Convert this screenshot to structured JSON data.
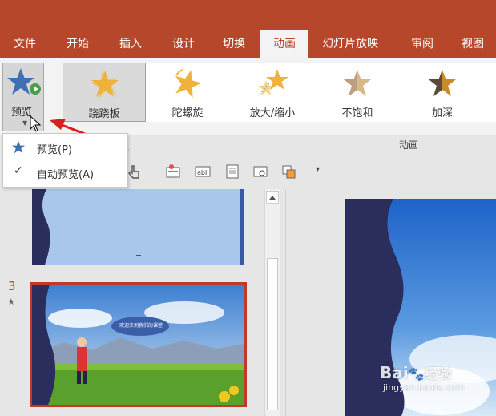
{
  "tabs": [
    "文件",
    "开始",
    "插入",
    "设计",
    "切换",
    "动画",
    "幻灯片放映",
    "审阅",
    "视图"
  ],
  "active_tab": "动画",
  "preview_button": {
    "label": "预览",
    "icon": "star-play-icon"
  },
  "animations": [
    {
      "label": "跷跷板",
      "icon": "teeter-star-icon",
      "selected": true
    },
    {
      "label": "陀螺旋",
      "icon": "spin-star-icon",
      "selected": false
    },
    {
      "label": "放大/缩小",
      "icon": "grow-shrink-star-icon",
      "selected": false
    },
    {
      "label": "不饱和",
      "icon": "desaturate-star-icon",
      "selected": false
    },
    {
      "label": "加深",
      "icon": "darken-star-icon",
      "selected": false
    }
  ],
  "group_label": "动画",
  "dropdown": {
    "items": [
      {
        "label": "预览(P)",
        "icon": "star-icon"
      },
      {
        "label": "自动预览(A)",
        "icon": "check-icon",
        "checked": true
      }
    ]
  },
  "slides": {
    "current_number": "3"
  },
  "slide_bubble_text": "欢迎来到我们的课堂",
  "watermark": {
    "brand": "Bai",
    "brand2": "经验",
    "url": "jingyan.baidu.com"
  },
  "colors": {
    "brand": "#b7472a",
    "slide_dark": "#2b2d5c",
    "slide_border": "#c0392b",
    "star_gold": "#f0b23a"
  }
}
